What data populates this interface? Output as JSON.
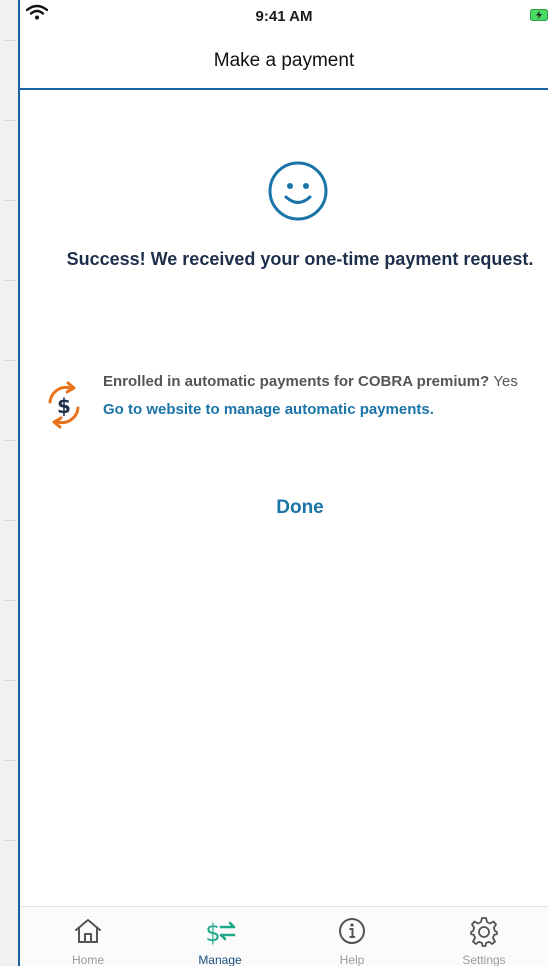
{
  "status_bar": {
    "time": "9:41 AM"
  },
  "header": {
    "title": "Make a payment"
  },
  "success": {
    "message": "Success! We received your one-time payment request."
  },
  "autopay": {
    "question": "Enrolled in automatic payments for COBRA premium?",
    "answer": "Yes",
    "link_text": "Go to website to manage automatic payments."
  },
  "actions": {
    "done_label": "Done"
  },
  "tab_bar": {
    "tabs": [
      {
        "label": "Home",
        "icon": "home-icon",
        "active": false
      },
      {
        "label": "Manage",
        "icon": "manage-payments-icon",
        "active": true
      },
      {
        "label": "Help",
        "icon": "info-icon",
        "active": false
      },
      {
        "label": "Settings",
        "icon": "gear-icon",
        "active": false
      }
    ]
  },
  "colors": {
    "accent": "#1a74a8",
    "header_rule": "#1a62a3",
    "tab_active": "#1fa98a",
    "autopay_orange": "#e8731a",
    "heading_text": "#1e2f4c"
  }
}
